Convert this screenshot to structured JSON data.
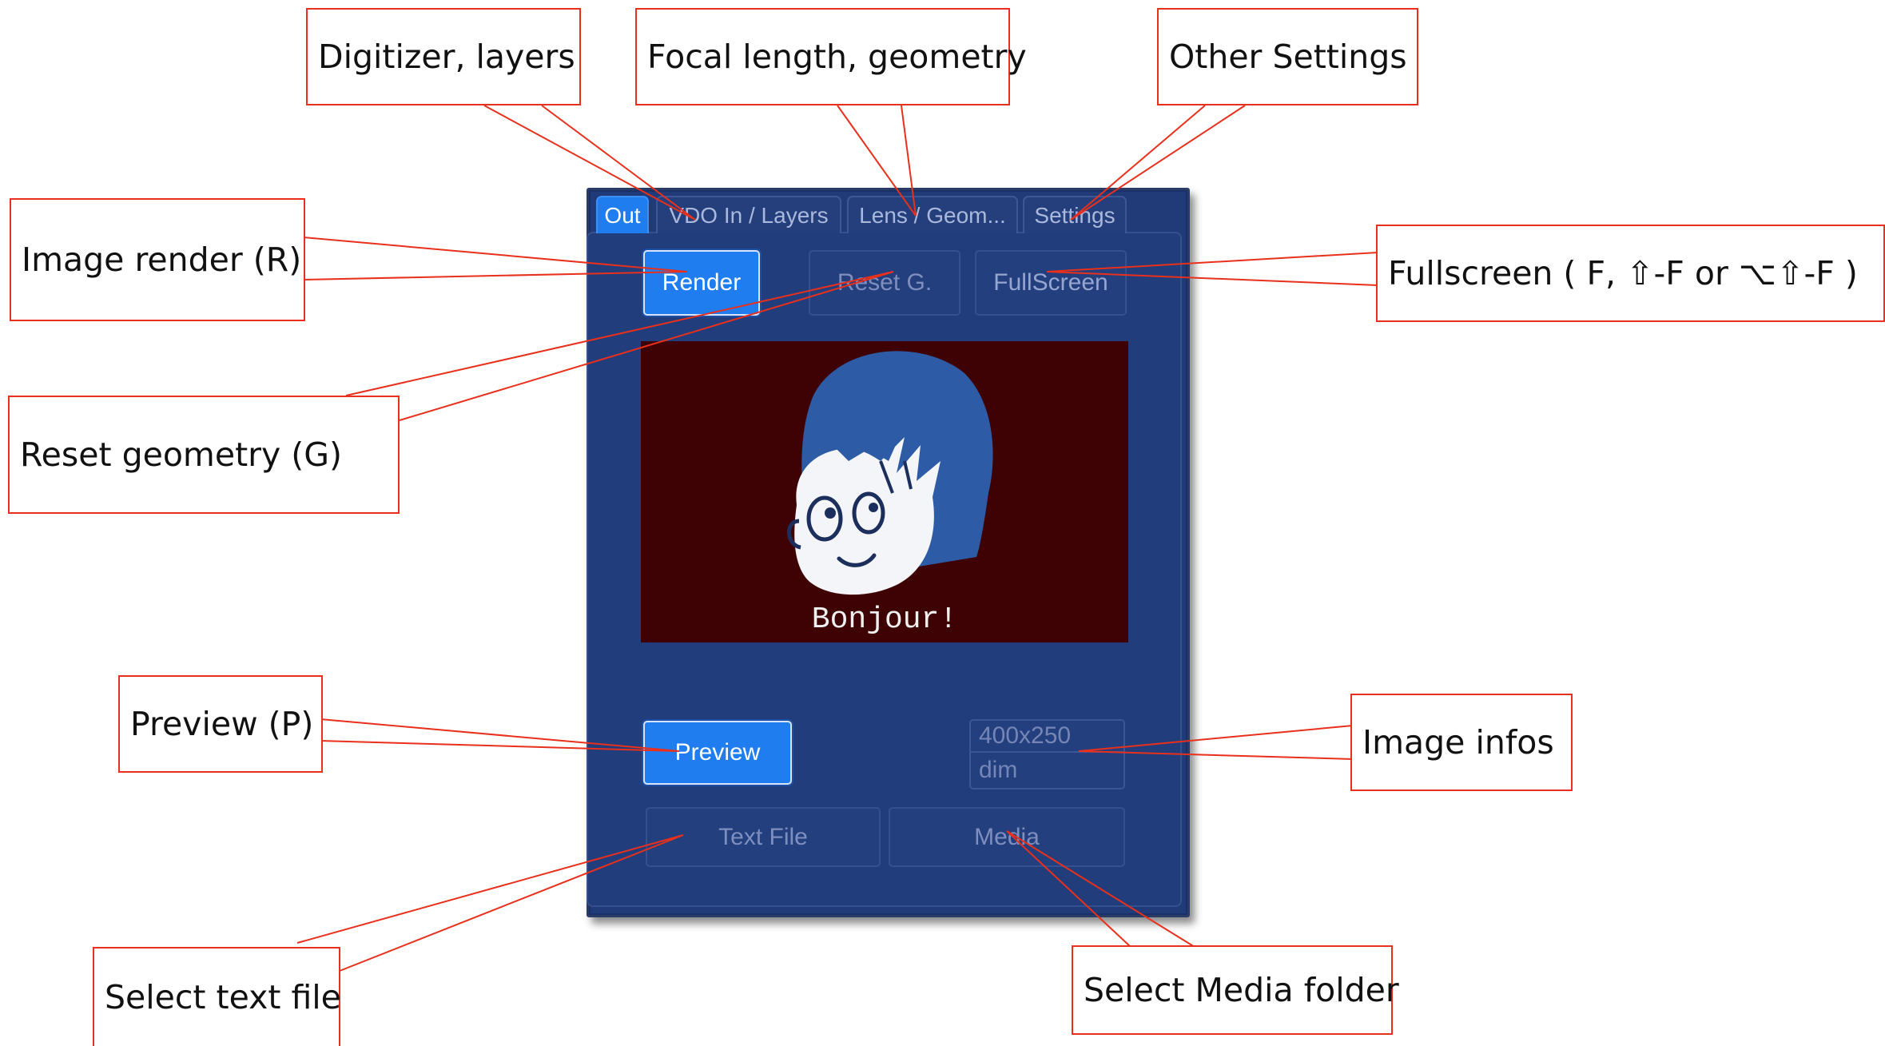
{
  "panel": {
    "tabs": [
      {
        "label": "Out",
        "active": true
      },
      {
        "label": "VDO In / Layers",
        "active": false
      },
      {
        "label": "Lens / Geom...",
        "active": false
      },
      {
        "label": "Settings",
        "active": false
      }
    ],
    "buttons": {
      "render": "Render",
      "reset_geometry": "Reset G.",
      "fullscreen": "FullScreen",
      "preview": "Preview",
      "text_file": "Text File",
      "media": "Media"
    },
    "preview_image": {
      "caption": "Bonjour!"
    },
    "image_info": {
      "size_placeholder": "400x250",
      "dim_placeholder": "dim"
    },
    "colors": {
      "panel_background": "#203b78",
      "accent_blue": "#1f7df0",
      "preview_background": "#3f0204",
      "callout_border": "#e8301c"
    }
  },
  "callouts": {
    "digitizer": "Digitizer, layers",
    "focal": "Focal length, geometry",
    "other_settings": "Other Settings",
    "image_render": "Image render (R)",
    "fullscreen": "Fullscreen ( F, ⇧-F or ⌥⇧-F )",
    "reset_geometry": "Reset geometry (G)",
    "preview": "Preview (P)",
    "image_infos": "Image infos",
    "select_text": "Select text file",
    "select_media": "Select Media folder"
  }
}
